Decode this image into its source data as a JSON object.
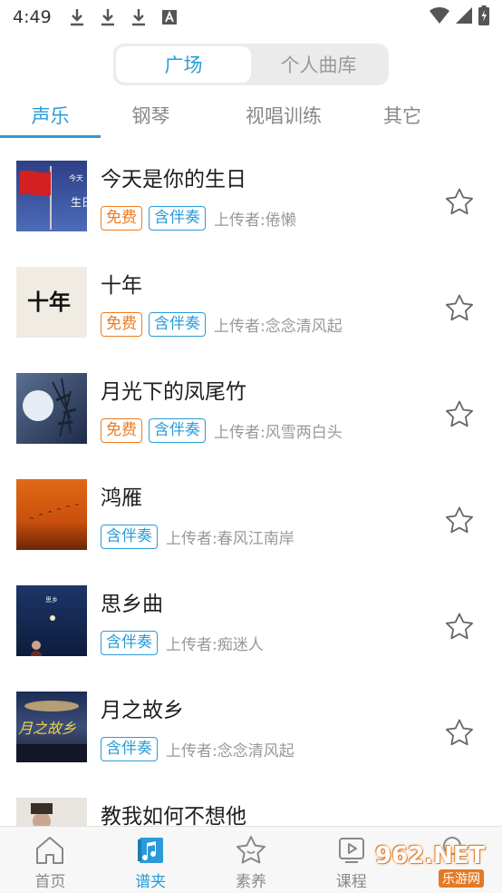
{
  "status_bar": {
    "time": "4:49",
    "left_icons": [
      "download-icon",
      "download-icon",
      "download-icon",
      "a-icon"
    ],
    "right_icons": [
      "wifi-icon",
      "signal-icon",
      "battery-icon"
    ]
  },
  "segment": {
    "items": [
      {
        "label": "广场",
        "active": true
      },
      {
        "label": "个人曲库",
        "active": false
      }
    ]
  },
  "tabs": [
    {
      "label": "声乐",
      "active": true
    },
    {
      "label": "钢琴",
      "active": false
    },
    {
      "label": "视唱训练",
      "active": false
    },
    {
      "label": "其它",
      "active": false
    }
  ],
  "songs": [
    {
      "title": "今天是你的生日",
      "tags": [
        "免费",
        "含伴奏"
      ],
      "uploader": "上传者:倦懒"
    },
    {
      "title": "十年",
      "tags": [
        "免费",
        "含伴奏"
      ],
      "uploader": "上传者:念念清风起"
    },
    {
      "title": "月光下的凤尾竹",
      "tags": [
        "免费",
        "含伴奏"
      ],
      "uploader": "上传者:风雪两白头"
    },
    {
      "title": "鸿雁",
      "tags": [
        "含伴奏"
      ],
      "uploader": "上传者:春风江南岸"
    },
    {
      "title": "思乡曲",
      "tags": [
        "含伴奏"
      ],
      "uploader": "上传者:痴迷人"
    },
    {
      "title": "月之故乡",
      "tags": [
        "含伴奏"
      ],
      "uploader": "上传者:念念清风起"
    },
    {
      "title": "教我如何不想他",
      "tags": [],
      "uploader": ""
    }
  ],
  "bottom_nav": [
    {
      "label": "首页",
      "icon": "home-icon",
      "active": false
    },
    {
      "label": "谱夹",
      "icon": "music-note-icon",
      "active": true
    },
    {
      "label": "素养",
      "icon": "star-face-icon",
      "active": false
    },
    {
      "label": "课程",
      "icon": "play-icon",
      "active": false
    },
    {
      "label": "",
      "icon": "profile-icon",
      "active": false
    }
  ],
  "watermark": {
    "main": "962.NET",
    "sub": "乐游网"
  },
  "colors": {
    "accent": "#2a9bd8",
    "free_tag": "#f07a1e",
    "text": "#1e1e1e",
    "muted": "#999999"
  }
}
